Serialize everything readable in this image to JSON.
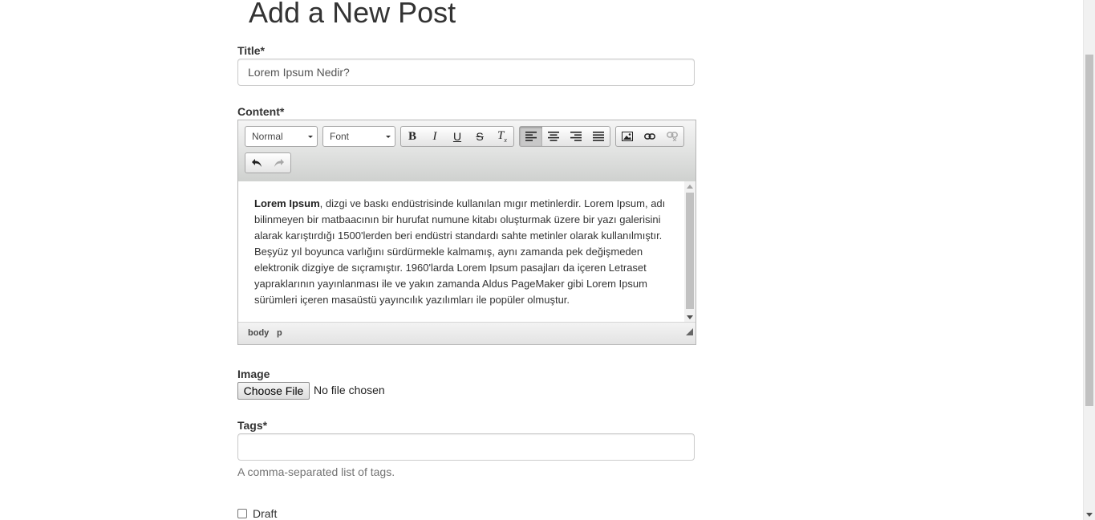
{
  "page": {
    "title": "Add a New Post"
  },
  "form": {
    "title_label": "Title*",
    "title_value": "Lorem Ipsum Nedir?",
    "content_label": "Content*",
    "image_label": "Image",
    "file_button": "Choose File",
    "file_status": "No file chosen",
    "tags_label": "Tags*",
    "tags_value": "",
    "tags_help": "A comma-separated list of tags.",
    "draft_label": "Draft",
    "draft_checked": false
  },
  "editor": {
    "format_combo": "Normal",
    "font_combo": "Font",
    "buttons": {
      "bold": "B",
      "italic": "I",
      "underline": "U",
      "strike": "S",
      "remove_format": "T"
    },
    "content_bold": "Lorem Ipsum",
    "content_rest": ", dizgi ve baskı endüstrisinde kullanılan mıgır metinlerdir. Lorem Ipsum, adı bilinmeyen bir matbaacının bir hurufat numune kitabı oluşturmak üzere bir yazı galerisini alarak karıştırdığı 1500'lerden beri endüstri standardı sahte metinler olarak kullanılmıştır. Beşyüz yıl boyunca varlığını sürdürmekle kalmamış, aynı zamanda pek değişmeden elektronik dizgiye de sıçramıştır. 1960'larda Lorem Ipsum pasajları da içeren Letraset yapraklarının yayınlanması ile ve yakın zamanda Aldus PageMaker gibi Lorem Ipsum sürümleri içeren masaüstü yayıncılık yazılımları ile popüler olmuştur.",
    "path": [
      "body",
      "p"
    ]
  }
}
